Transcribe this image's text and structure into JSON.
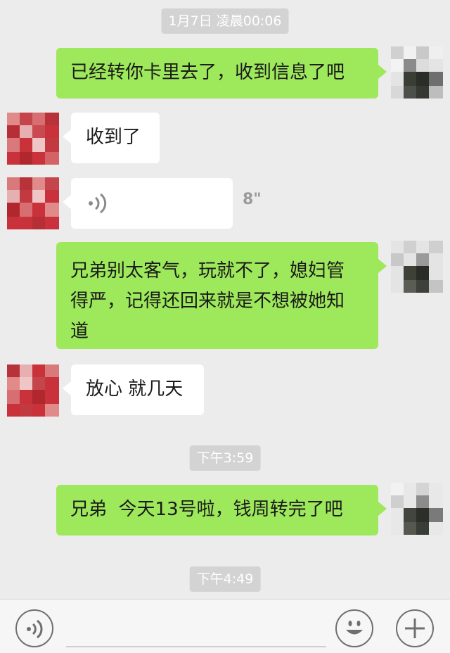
{
  "chat": {
    "timestamps": [
      "1月7日 凌晨00:06",
      "下午3:59",
      "下午4:49"
    ],
    "messages": [
      {
        "sender": "me",
        "type": "text",
        "text": "已经转你卡里去了，收到信息了吧"
      },
      {
        "sender": "other",
        "type": "text",
        "text": "收到了"
      },
      {
        "sender": "other",
        "type": "voice",
        "duration": "8\""
      },
      {
        "sender": "me",
        "type": "text",
        "lines": [
          "兄弟别太客气，玩就不了，媳妇管",
          "得严，记得还回来就是不想被她知",
          "道"
        ]
      },
      {
        "sender": "other",
        "type": "text",
        "text": "放心 就几天"
      },
      {
        "sender": "me",
        "type": "text",
        "text": "兄弟  今天13号啦，钱周转完了吧"
      }
    ]
  },
  "colors": {
    "background": "#ececec",
    "my_bubble": "#9ee85b",
    "other_bubble": "#ffffff",
    "timestamp_bg": "#d3d3d3"
  },
  "bottom_bar": {
    "icons": [
      "voice-input-icon",
      "emoji-icon",
      "more-plus-icon"
    ]
  }
}
